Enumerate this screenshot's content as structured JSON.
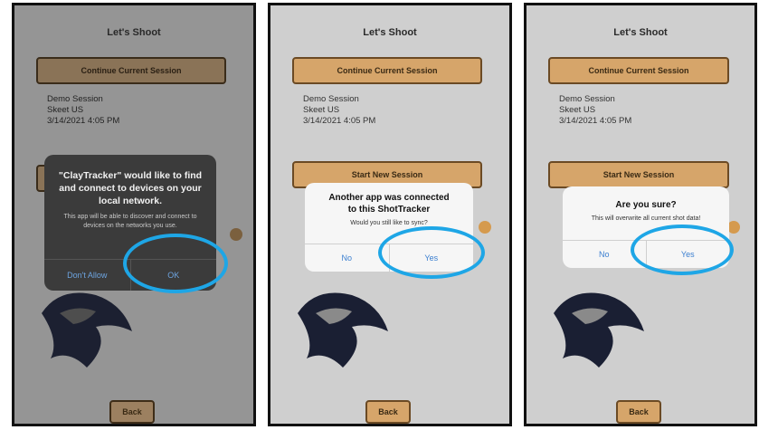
{
  "screens": [
    {
      "title": "Let's Shoot",
      "continue_label": "Continue Current Session",
      "session": {
        "name": "Demo Session",
        "type": "Skeet US",
        "date": "3/14/2021 4:05 PM"
      },
      "back_label": "Back",
      "alert": {
        "title": "\"ClayTracker\" would like to find and connect to devices on your local network.",
        "message": "This app will be able to discover and connect to devices on the networks you use.",
        "cancel": "Don't Allow",
        "confirm": "OK"
      }
    },
    {
      "title": "Let's Shoot",
      "continue_label": "Continue Current Session",
      "session": {
        "name": "Demo Session",
        "type": "Skeet US",
        "date": "3/14/2021 4:05 PM"
      },
      "start_label": "Start New Session",
      "back_label": "Back",
      "alert": {
        "title": "Another app was connected to this ShotTracker",
        "message": "Would you still like to sync?",
        "cancel": "No",
        "confirm": "Yes"
      }
    },
    {
      "title": "Let's Shoot",
      "continue_label": "Continue Current Session",
      "session": {
        "name": "Demo Session",
        "type": "Skeet US",
        "date": "3/14/2021 4:05 PM"
      },
      "start_label": "Start New Session",
      "back_label": "Back",
      "alert": {
        "title": "Are you sure?",
        "message": "This will overwrite all current shot data!",
        "cancel": "No",
        "confirm": "Yes"
      }
    }
  ],
  "colors": {
    "button_fill": "#d6a56a",
    "highlight_ring": "#1ea6e6",
    "alert_action": "#3b7fd0"
  }
}
